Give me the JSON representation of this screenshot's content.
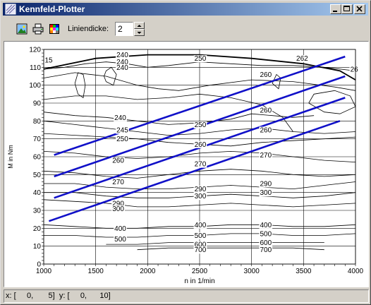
{
  "window": {
    "title": "Kennfeld-Plotter",
    "icons": {
      "app": "plot-app-icon",
      "minimize": "minimize-icon",
      "maximize": "maximize-icon",
      "close": "close-icon"
    }
  },
  "toolbar": {
    "icons": [
      "image-icon",
      "printer-icon",
      "color-palette-icon"
    ],
    "linewidth_label": "Liniendicke:",
    "linewidth_value": "2"
  },
  "status": {
    "x_prefix": "x: [",
    "x_from": "0,",
    "x_to": "5]",
    "y_prefix": "y: [",
    "y_from": "0,",
    "y_to": "10]"
  },
  "chart_data": {
    "type": "line",
    "xlabel": "n in 1/min",
    "ylabel": "M in Nm",
    "xlim": [
      1000,
      4000
    ],
    "ylim": [
      0,
      120
    ],
    "xticks": [
      "1000",
      "1500",
      "2000",
      "2500",
      "3000",
      "3500",
      "4000"
    ],
    "yticks": [
      "0",
      "10",
      "20",
      "30",
      "40",
      "50",
      "60",
      "70",
      "80",
      "90",
      "100",
      "110",
      "120"
    ],
    "grid": true,
    "max_torque_curve": {
      "x": [
        1000,
        1500,
        2000,
        2500,
        3000,
        3500,
        3850,
        4000
      ],
      "y": [
        109,
        115,
        117,
        117,
        115,
        112,
        108,
        103
      ]
    },
    "series": [
      {
        "color": "#1010c8",
        "x": [
          1100,
          3900
        ],
        "y": [
          61,
          116
        ]
      },
      {
        "color": "#1010c8",
        "x": [
          1100,
          3900
        ],
        "y": [
          49,
          105
        ]
      },
      {
        "color": "#1010c8",
        "x": [
          1100,
          3900
        ],
        "y": [
          37,
          93
        ]
      },
      {
        "color": "#1010c8",
        "x": [
          1050,
          3850
        ],
        "y": [
          24,
          80
        ]
      }
    ],
    "contour_labels": [
      {
        "text": "15",
        "x": 1010,
        "y": 114
      },
      {
        "text": "240",
        "x": 1700,
        "y": 117
      },
      {
        "text": "240",
        "x": 1700,
        "y": 113
      },
      {
        "text": "240",
        "x": 1700,
        "y": 110
      },
      {
        "text": "250",
        "x": 2450,
        "y": 115
      },
      {
        "text": "262",
        "x": 3430,
        "y": 115
      },
      {
        "text": "26",
        "x": 3950,
        "y": 109
      },
      {
        "text": "260",
        "x": 3080,
        "y": 106
      },
      {
        "text": "240",
        "x": 1680,
        "y": 82
      },
      {
        "text": "245",
        "x": 1700,
        "y": 75
      },
      {
        "text": "250",
        "x": 1700,
        "y": 70
      },
      {
        "text": "250",
        "x": 2450,
        "y": 78
      },
      {
        "text": "260",
        "x": 3080,
        "y": 86
      },
      {
        "text": "260",
        "x": 3080,
        "y": 75
      },
      {
        "text": "260",
        "x": 2450,
        "y": 67
      },
      {
        "text": "260",
        "x": 1660,
        "y": 58
      },
      {
        "text": "270",
        "x": 2450,
        "y": 56
      },
      {
        "text": "270",
        "x": 3080,
        "y": 61
      },
      {
        "text": "270",
        "x": 1660,
        "y": 46
      },
      {
        "text": "290",
        "x": 2450,
        "y": 42
      },
      {
        "text": "300",
        "x": 2450,
        "y": 38
      },
      {
        "text": "290",
        "x": 3080,
        "y": 45
      },
      {
        "text": "300",
        "x": 3080,
        "y": 40
      },
      {
        "text": "290",
        "x": 1660,
        "y": 34
      },
      {
        "text": "300",
        "x": 1660,
        "y": 31
      },
      {
        "text": "400",
        "x": 1680,
        "y": 20
      },
      {
        "text": "500",
        "x": 1680,
        "y": 14
      },
      {
        "text": "400",
        "x": 2450,
        "y": 22
      },
      {
        "text": "500",
        "x": 2450,
        "y": 16
      },
      {
        "text": "600",
        "x": 2450,
        "y": 11
      },
      {
        "text": "700",
        "x": 2450,
        "y": 8
      },
      {
        "text": "400",
        "x": 3080,
        "y": 22
      },
      {
        "text": "500",
        "x": 3080,
        "y": 17
      },
      {
        "text": "600",
        "x": 3080,
        "y": 12
      },
      {
        "text": "700",
        "x": 3080,
        "y": 8
      }
    ],
    "contour_lines": [
      {
        "x": [
          1000,
          1200,
          1400,
          1600,
          1800,
          2000,
          2200,
          2500,
          2800,
          3100,
          3400,
          3700,
          4000
        ],
        "y": [
          109,
          110,
          112,
          113,
          112,
          110,
          111,
          113,
          112,
          111,
          111,
          110,
          108
        ]
      },
      {
        "x": [
          1000,
          1300,
          1600,
          1900,
          2100,
          2300,
          2600,
          3000,
          3400,
          3800,
          4000
        ],
        "y": [
          104,
          107,
          105,
          100,
          98,
          97,
          100,
          103,
          102,
          99,
          97
        ]
      },
      {
        "x": [
          1000,
          1300,
          1600,
          1900,
          2200,
          2500,
          2800,
          3100,
          3300,
          3400
        ],
        "y": [
          92,
          94,
          94,
          92,
          93,
          95,
          93,
          89,
          82,
          74
        ]
      },
      {
        "x": [
          1000,
          1300,
          1600,
          1900,
          2200,
          2500,
          2800,
          3000,
          3200,
          3400,
          3600
        ],
        "y": [
          85,
          83,
          82,
          80,
          78,
          79,
          81,
          84,
          83,
          82,
          83
        ]
      },
      {
        "x": [
          1000,
          1300,
          1600,
          1900,
          2200,
          2500,
          2800,
          3100,
          3400,
          3700,
          4000
        ],
        "y": [
          80,
          78,
          76,
          74,
          72,
          73,
          75,
          76,
          74,
          73,
          74
        ]
      },
      {
        "x": [
          1000,
          1300,
          1600,
          1900,
          2200,
          2500,
          2800,
          3100,
          3400,
          3700,
          4000
        ],
        "y": [
          73,
          72,
          71,
          70,
          68,
          67,
          66,
          68,
          69,
          70,
          71
        ]
      },
      {
        "x": [
          1000,
          1300,
          1600,
          1900,
          2200,
          2500,
          2800,
          3100,
          3400,
          3700,
          4000
        ],
        "y": [
          63,
          62,
          60,
          59,
          60,
          62,
          63,
          62,
          60,
          58,
          57
        ]
      },
      {
        "x": [
          1000,
          1300,
          1600,
          1900,
          2200,
          2500,
          2800,
          3100,
          3400,
          3700,
          4000
        ],
        "y": [
          52,
          51,
          49,
          48,
          50,
          52,
          53,
          52,
          50,
          49,
          50
        ]
      },
      {
        "x": [
          1000,
          1300,
          1600,
          1900,
          2200,
          2500,
          2800,
          3100,
          3400,
          3700,
          4000
        ],
        "y": [
          45,
          45,
          43,
          42,
          42,
          43,
          44,
          43,
          42,
          44,
          46
        ]
      },
      {
        "x": [
          1000,
          1300,
          1600,
          1900,
          2200,
          2500,
          2800,
          3100,
          3400,
          3700,
          4000
        ],
        "y": [
          40,
          40,
          38,
          37,
          37,
          38,
          39,
          38,
          37,
          38,
          40
        ]
      },
      {
        "x": [
          1000,
          1300,
          1600,
          1900,
          2200,
          2500,
          2800,
          3100,
          3400,
          3700,
          4000
        ],
        "y": [
          36,
          35,
          34,
          32,
          32,
          33,
          34,
          33,
          32,
          33,
          34
        ]
      },
      {
        "x": [
          1000,
          1300,
          1600,
          1900,
          2200,
          2500,
          2800,
          3100,
          3400,
          3700,
          4000
        ],
        "y": [
          22,
          21,
          20,
          20,
          21,
          21,
          22,
          22,
          21,
          21,
          22
        ]
      },
      {
        "x": [
          1000,
          1300,
          1600,
          1900,
          2200,
          2500,
          2800,
          3100,
          3400,
          3700,
          4000
        ],
        "y": [
          16,
          16,
          15,
          15,
          16,
          16,
          17,
          17,
          16,
          16,
          17
        ]
      },
      {
        "x": [
          1600,
          1900,
          2200,
          2500,
          2800,
          3100,
          3400,
          3700
        ],
        "y": [
          11,
          11,
          12,
          12,
          12,
          12,
          12,
          12
        ]
      },
      {
        "x": [
          1900,
          2200,
          2500,
          2800,
          3100,
          3400,
          3700
        ],
        "y": [
          8,
          9,
          9,
          9,
          9,
          9,
          8
        ]
      },
      {
        "x": [
          1300,
          1330,
          1380,
          1400,
          1380,
          1330,
          1300
        ],
        "y": [
          101,
          95,
          93,
          100,
          106,
          107,
          101
        ]
      },
      {
        "x": [
          1600,
          1670,
          1700,
          1650,
          1600,
          1580,
          1600
        ],
        "y": [
          102,
          100,
          106,
          110,
          108,
          105,
          102
        ]
      },
      {
        "x": [
          3550,
          3700,
          3850,
          4000,
          3950,
          3800,
          3600,
          3550
        ],
        "y": [
          90,
          85,
          84,
          88,
          94,
          97,
          95,
          90
        ]
      },
      {
        "x": [
          3200,
          3260,
          3280,
          3240,
          3200
        ],
        "y": [
          101,
          98,
          104,
          106,
          101
        ]
      }
    ]
  }
}
